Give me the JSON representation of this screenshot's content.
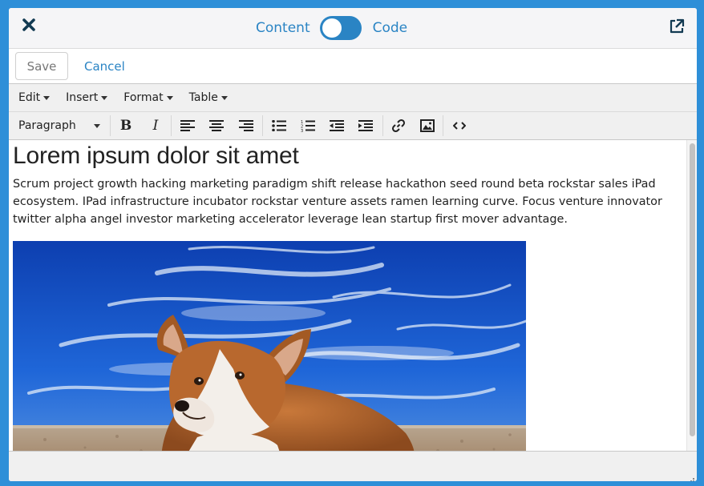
{
  "header": {
    "toggle_left_label": "Content",
    "toggle_right_label": "Code",
    "close_icon": "close-icon",
    "external_icon": "external-link-icon"
  },
  "actions": {
    "save_label": "Save",
    "cancel_label": "Cancel"
  },
  "menubar": {
    "items": [
      {
        "label": "Edit"
      },
      {
        "label": "Insert"
      },
      {
        "label": "Format"
      },
      {
        "label": "Table"
      }
    ]
  },
  "toolbar": {
    "block_format": "Paragraph",
    "buttons": [
      "bold-icon",
      "italic-icon",
      "align-left-icon",
      "align-center-icon",
      "align-right-icon",
      "bullet-list-icon",
      "numbered-list-icon",
      "outdent-icon",
      "indent-icon",
      "link-icon",
      "image-icon",
      "source-code-icon"
    ]
  },
  "document": {
    "heading": "Lorem ipsum dolor sit amet",
    "paragraph": "Scrum project growth hacking marketing paradigm shift release hackathon seed round beta rockstar sales iPad ecosystem. IPad infrastructure incubator rockstar venture assets ramen learning curve. Focus venture innovator twitter alpha angel investor marketing accelerator leverage lean startup first mover advantage."
  },
  "colors": {
    "frame": "#2e8fd8",
    "accent": "#2a84c4",
    "toolbar_bg": "#f0f0f0"
  }
}
